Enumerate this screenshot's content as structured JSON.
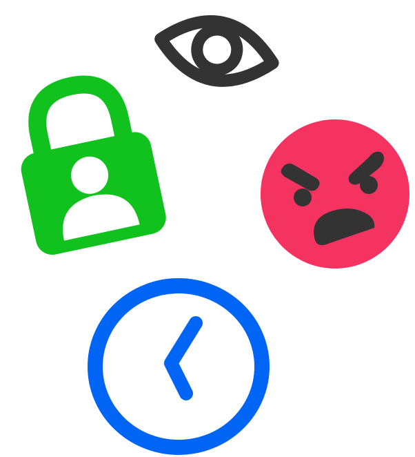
{
  "icons": [
    {
      "name": "eye-icon",
      "color": "#333333"
    },
    {
      "name": "lock-with-user-icon",
      "color": "#11c21f"
    },
    {
      "name": "angry-face-icon",
      "color": "#f53360",
      "feature_color": "#333333"
    },
    {
      "name": "clock-icon",
      "color": "#0064f5"
    }
  ]
}
